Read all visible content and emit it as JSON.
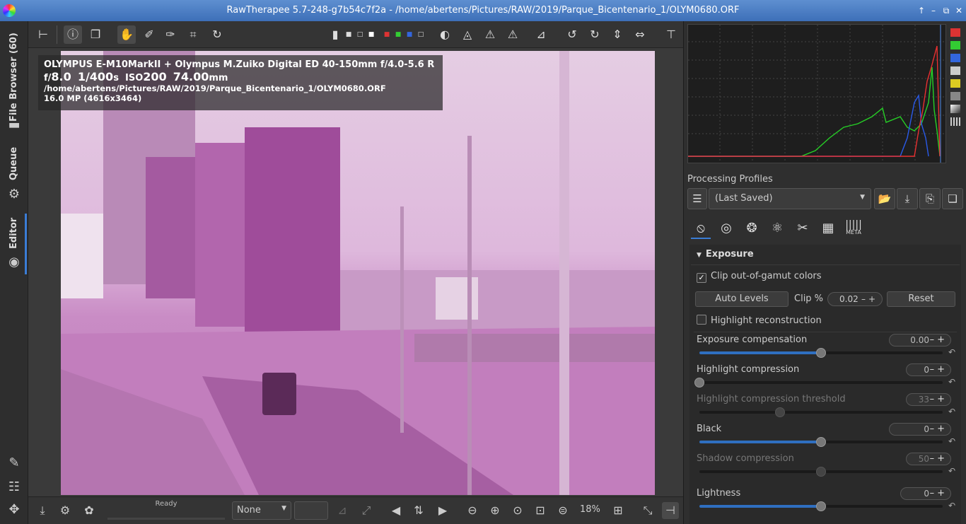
{
  "window": {
    "title": "RawTherapee 5.7-248-g7b54c7f2a - /home/abertens/Pictures/RAW/2019/Parque_Bicentenario_1/OLYM0680.ORF",
    "controls": [
      "↑",
      "–",
      "⧉",
      "✕"
    ]
  },
  "left_tabs": {
    "file_browser": "File Browser (60)",
    "queue": "Queue",
    "editor": "Editor"
  },
  "info": {
    "camera": "OLYMPUS E-M10MarkII + Olympus M.Zuiko Digital ED 40-150mm f/4.0-5.6 R",
    "f_prefix": "f/",
    "aperture": "8.0",
    "shutter": "1/400",
    "shutter_unit": "s",
    "iso_prefix": "ISO",
    "iso": "200",
    "focal": "74.00",
    "focal_unit": "mm",
    "path": "/home/abertens/Pictures/RAW/2019/Parque_Bicentenario_1/OLYM0680.ORF",
    "size": "16.0 MP (4616x3464)"
  },
  "bottom": {
    "status": "Ready",
    "preview_mode": "None",
    "zoom": "18%"
  },
  "profiles": {
    "label": "Processing Profiles",
    "selected": "(Last Saved)"
  },
  "tool_tabs": {
    "meta": "META"
  },
  "exposure": {
    "title": "Exposure",
    "clip_label": "Clip out-of-gamut colors",
    "clip_checked": true,
    "auto_levels": "Auto Levels",
    "clip_pct_label": "Clip %",
    "clip_pct_value": "0.02",
    "reset": "Reset",
    "highlight_recon": "Highlight reconstruction",
    "highlight_recon_checked": false,
    "sliders": [
      {
        "label": "Exposure compensation",
        "value": "0.00",
        "fraction": 0.5,
        "enabled": true
      },
      {
        "label": "Highlight compression",
        "value": "0",
        "fraction": 0.0,
        "enabled": true
      },
      {
        "label": "Highlight compression threshold",
        "value": "33",
        "fraction": 0.33,
        "enabled": false
      },
      {
        "label": "Black",
        "value": "0",
        "fraction": 0.5,
        "enabled": true
      },
      {
        "label": "Shadow compression",
        "value": "50",
        "fraction": 0.5,
        "enabled": false
      },
      {
        "label": "Lightness",
        "value": "0",
        "fraction": 0.5,
        "enabled": true
      }
    ]
  },
  "colors": {
    "accent": "#3a7cd5",
    "image_tint": "#c078bc"
  }
}
